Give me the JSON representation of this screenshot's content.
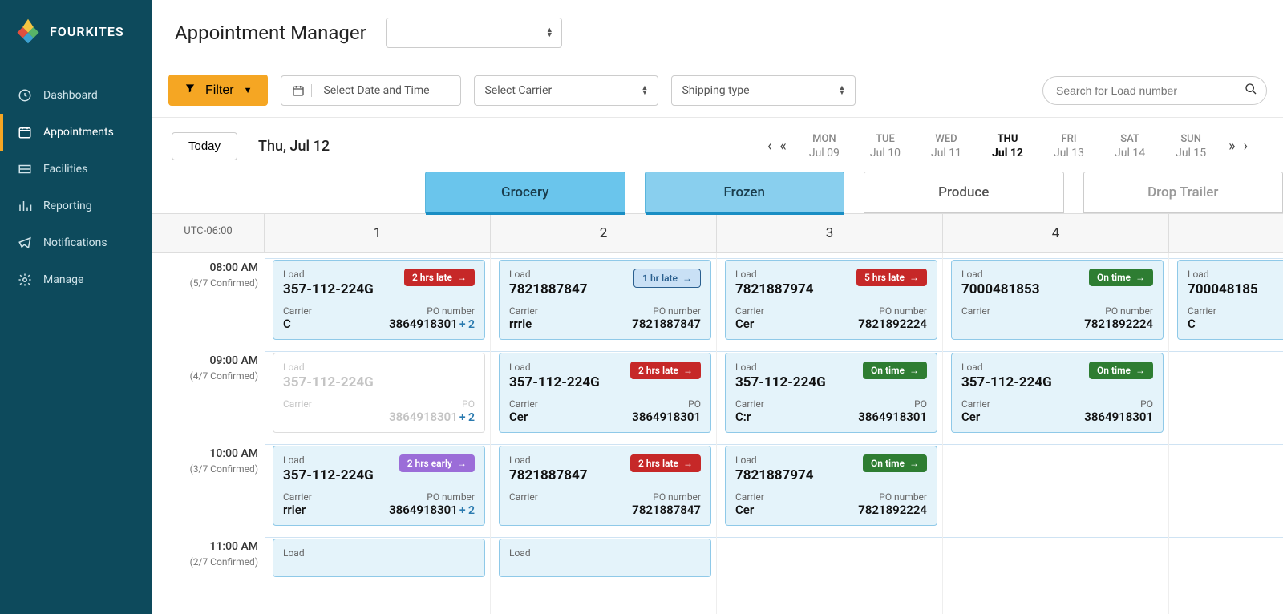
{
  "brand": "FOURKITES",
  "pageTitle": "Appointment Manager",
  "facilitySelect": "",
  "filterLabel": "Filter",
  "dateSelect": "Select Date and Time",
  "carrierSelect": "Select Carrier",
  "shippingSelect": "Shipping type",
  "searchPlaceholder": "Search for Load number",
  "todayBtn": "Today",
  "currentDate": "Thu, Jul 12",
  "timezone": "UTC-06:00",
  "nav": [
    {
      "label": "Dashboard",
      "active": false
    },
    {
      "label": "Appointments",
      "active": true
    },
    {
      "label": "Facilities",
      "active": false
    },
    {
      "label": "Reporting",
      "active": false
    },
    {
      "label": "Notifications",
      "active": false
    },
    {
      "label": "Manage",
      "active": false
    }
  ],
  "dates": [
    {
      "dow": "MON",
      "num": "Jul 09",
      "active": false
    },
    {
      "dow": "TUE",
      "num": "Jul 10",
      "active": false
    },
    {
      "dow": "WED",
      "num": "Jul 11",
      "active": false
    },
    {
      "dow": "THU",
      "num": "Jul 12",
      "active": true
    },
    {
      "dow": "FRI",
      "num": "Jul 13",
      "active": false
    },
    {
      "dow": "SAT",
      "num": "Jul 14",
      "active": false
    },
    {
      "dow": "SUN",
      "num": "Jul 15",
      "active": false
    }
  ],
  "catTabs": [
    {
      "label": "Grocery",
      "style": "blue"
    },
    {
      "label": "Frozen",
      "style": "blue light"
    },
    {
      "label": "Produce",
      "style": "white"
    },
    {
      "label": "Drop Trailer",
      "style": "gray"
    }
  ],
  "columns": [
    "1",
    "2",
    "3",
    "4",
    ""
  ],
  "rows": [
    {
      "time": "08:00 AM",
      "confirmed": "(5/7 Confirmed)",
      "cells": [
        {
          "loadLabel": "Load",
          "loadId": "357-112-224G",
          "badgeText": "2 hrs late",
          "badgeClass": "red",
          "carrierLabel": "Carrier",
          "carrierValue": "C",
          "poLabel": "PO number",
          "poValue": "3864918301",
          "poExtra": "+ 2",
          "style": ""
        },
        {
          "loadLabel": "Load",
          "loadId": "7821887847",
          "badgeText": "1 hr late",
          "badgeClass": "blueoutline",
          "carrierLabel": "Carrier",
          "carrierValue": "rrrie",
          "poLabel": "PO number",
          "poValue": "7821887847",
          "poExtra": "",
          "style": ""
        },
        {
          "loadLabel": "Load",
          "loadId": "7821887974",
          "badgeText": "5 hrs late",
          "badgeClass": "red",
          "carrierLabel": "Carrier",
          "carrierValue": "Cer",
          "poLabel": "PO number",
          "poValue": "7821892224",
          "poExtra": "",
          "style": ""
        },
        {
          "loadLabel": "Load",
          "loadId": "7000481853",
          "badgeText": "On time",
          "badgeClass": "green",
          "carrierLabel": "Carrier",
          "carrierValue": "",
          "poLabel": "PO number",
          "poValue": "7821892224",
          "poExtra": "",
          "style": ""
        },
        {
          "loadLabel": "Load",
          "loadId": "700048185",
          "badgeText": "",
          "badgeClass": "",
          "carrierLabel": "Carrier",
          "carrierValue": "C",
          "poLabel": "",
          "poValue": "",
          "poExtra": "",
          "style": ""
        }
      ]
    },
    {
      "time": "09:00 AM",
      "confirmed": "(4/7 Confirmed)",
      "cells": [
        {
          "loadLabel": "Load",
          "loadId": "357-112-224G",
          "badgeText": "",
          "badgeClass": "",
          "carrierLabel": "Carrier",
          "carrierValue": "",
          "poLabel": "PO",
          "poValue": "3864918301",
          "poExtra": "+ 2",
          "style": "dim"
        },
        {
          "loadLabel": "Load",
          "loadId": "357-112-224G",
          "badgeText": "2 hrs late",
          "badgeClass": "red",
          "carrierLabel": "Carrier",
          "carrierValue": "Cer",
          "poLabel": "PO",
          "poValue": "3864918301",
          "poExtra": "",
          "style": ""
        },
        {
          "loadLabel": "Load",
          "loadId": "357-112-224G",
          "badgeText": "On time",
          "badgeClass": "green",
          "carrierLabel": "Carrier",
          "carrierValue": "C:r",
          "poLabel": "PO",
          "poValue": "3864918301",
          "poExtra": "",
          "style": ""
        },
        {
          "loadLabel": "Load",
          "loadId": "357-112-224G",
          "badgeText": "On time",
          "badgeClass": "green",
          "carrierLabel": "Carrier",
          "carrierValue": "Cer",
          "poLabel": "PO",
          "poValue": "3864918301",
          "poExtra": "",
          "style": ""
        },
        null
      ]
    },
    {
      "time": "10:00 AM",
      "confirmed": "(3/7 Confirmed)",
      "cells": [
        {
          "loadLabel": "Load",
          "loadId": "357-112-224G",
          "badgeText": "2 hrs early",
          "badgeClass": "purple",
          "carrierLabel": "Carrier",
          "carrierValue": "rrier",
          "poLabel": "PO number",
          "poValue": "3864918301",
          "poExtra": "+ 2",
          "style": ""
        },
        {
          "loadLabel": "Load",
          "loadId": "7821887847",
          "badgeText": "2 hrs late",
          "badgeClass": "red",
          "carrierLabel": "Carrier",
          "carrierValue": "",
          "poLabel": "PO number",
          "poValue": "7821887847",
          "poExtra": "",
          "style": ""
        },
        {
          "loadLabel": "Load",
          "loadId": "7821887974",
          "badgeText": "On time",
          "badgeClass": "green",
          "carrierLabel": "Carrier",
          "carrierValue": "Cer",
          "poLabel": "PO number",
          "poValue": "7821892224",
          "poExtra": "",
          "style": ""
        },
        null,
        null
      ]
    },
    {
      "time": "11:00 AM",
      "confirmed": "(2/7 Confirmed)",
      "cells": [
        {
          "loadLabel": "Load",
          "loadId": "",
          "badgeText": "",
          "badgeClass": "",
          "carrierLabel": "",
          "carrierValue": "",
          "poLabel": "",
          "poValue": "",
          "poExtra": "",
          "style": ""
        },
        {
          "loadLabel": "Load",
          "loadId": "",
          "badgeText": "",
          "badgeClass": "",
          "carrierLabel": "",
          "carrierValue": "",
          "poLabel": "",
          "poValue": "",
          "poExtra": "",
          "style": ""
        },
        null,
        null,
        null
      ]
    }
  ]
}
